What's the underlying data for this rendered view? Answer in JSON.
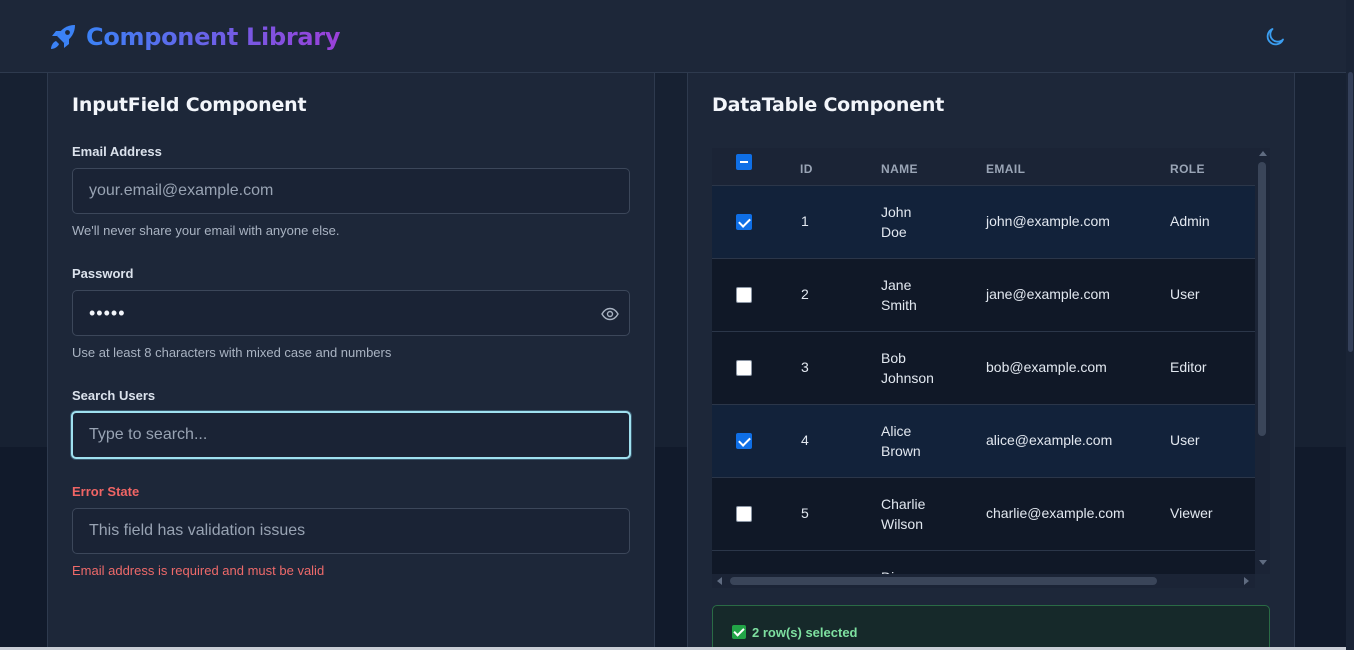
{
  "app": {
    "title": "Component Library",
    "accent_from": "#3b82f6",
    "accent_to": "#9b40d8",
    "logo_icon": "rocket-icon",
    "theme_icon": "moon-icon"
  },
  "input_card": {
    "title": "InputField Component",
    "email": {
      "label": "Email Address",
      "placeholder": "your.email@example.com",
      "value": "",
      "help": "We'll never share your email with anyone else."
    },
    "password": {
      "label": "Password",
      "value": "•••••",
      "help": "Use at least 8 characters with mixed case and numbers",
      "toggle_icon": "eye-icon"
    },
    "search": {
      "label": "Search Users",
      "placeholder": "Type to search...",
      "value": ""
    },
    "error": {
      "label": "Error State",
      "placeholder": "This field has validation issues",
      "value": "",
      "message": "Email address is required and must be valid",
      "color": "#f06565"
    }
  },
  "table_card": {
    "title": "DataTable Component",
    "columns": [
      "ID",
      "NAME",
      "EMAIL",
      "ROLE"
    ],
    "header_checkbox": "indeterminate",
    "rows": [
      {
        "id": "1",
        "first": "John",
        "last": "Doe",
        "email": "john@example.com",
        "role": "Admin",
        "selected": true
      },
      {
        "id": "2",
        "first": "Jane",
        "last": "Smith",
        "email": "jane@example.com",
        "role": "User",
        "selected": false
      },
      {
        "id": "3",
        "first": "Bob",
        "last": "Johnson",
        "email": "bob@example.com",
        "role": "Editor",
        "selected": false
      },
      {
        "id": "4",
        "first": "Alice",
        "last": "Brown",
        "email": "alice@example.com",
        "role": "User",
        "selected": true
      },
      {
        "id": "5",
        "first": "Charlie",
        "last": "Wilson",
        "email": "charlie@example.com",
        "role": "Viewer",
        "selected": false
      },
      {
        "id": "",
        "first": "Di",
        "last": "",
        "email": "",
        "role": "",
        "selected": false
      }
    ],
    "selection_text": "2 row(s) selected",
    "selection_color": "#7ee0a0"
  }
}
